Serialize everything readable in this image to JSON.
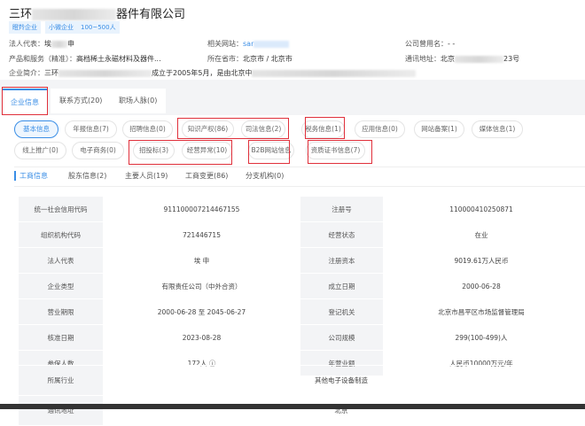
{
  "company": {
    "name_prefix": "三环",
    "name_suffix": "器件有限公司",
    "tags": [
      "瞪羚企业",
      "小微企业",
      "100~500人"
    ]
  },
  "info": {
    "legal_rep_label": "法人代表：",
    "legal_rep_a": "埃",
    "legal_rep_b": "申",
    "website_label": "相关网站：",
    "website": "sar",
    "former_name_label": "公司曾用名：",
    "former_name": "- -",
    "products_label": "产品和服务（精准）：",
    "products": "高档稀土永磁材料及器件...",
    "province_label": "所在省市：",
    "province": "北京市 / 北京市",
    "address_label": "通讯地址：",
    "address_a": "北京",
    "address_b": "23号",
    "intro_label": "企业简介：",
    "intro_a": "三环",
    "intro_b": "成立于2005年5月，是由北京中"
  },
  "tabs": [
    "企业信息",
    "联系方式(20)",
    "职场人脉(0)"
  ],
  "pills_row1": [
    "基本信息",
    "年报信息(7)",
    "招聘信息(0)",
    "知识产权(86)",
    "司法信息(2)",
    "税务信息(1)",
    "应用信息(0)",
    "网站备案(1)",
    "媒体信息(1)"
  ],
  "pills_row2": [
    "线上推广(0)",
    "电子商务(0)",
    "招投标(3)",
    "经营异常(10)",
    "B2B网站信息",
    "资质证书信息(7)"
  ],
  "subtabs": [
    "工商信息",
    "股东信息(2)",
    "主要人员(19)",
    "工商变更(86)",
    "分支机构(0)"
  ],
  "table": [
    [
      "统一社会信用代码",
      "911100007214467155",
      "注册号",
      "110000410250871"
    ],
    [
      "组织机构代码",
      "721446715",
      "经营状态",
      "在业"
    ],
    [
      "法人代表",
      "埃 申",
      "注册资本",
      "9019.61万人民币"
    ],
    [
      "企业类型",
      "有限责任公司（中外合资）",
      "成立日期",
      "2000-06-28"
    ],
    [
      "营业期限",
      "2000-06-28 至 2045-06-27",
      "登记机关",
      "北京市昌平区市场监督管理局"
    ],
    [
      "核准日期",
      "2023-08-28",
      "公司规模",
      "299(100-499)人"
    ],
    [
      "参保人数",
      "172人 ⓘ",
      "年营业额",
      "人民币10000万元/年"
    ]
  ],
  "table2": [
    [
      "所属行业",
      "其他电子设备制造"
    ],
    [
      "通讯地址",
      "北京"
    ]
  ],
  "colors": {
    "accent": "#3a8ee6",
    "highlight": "#e0303b"
  }
}
